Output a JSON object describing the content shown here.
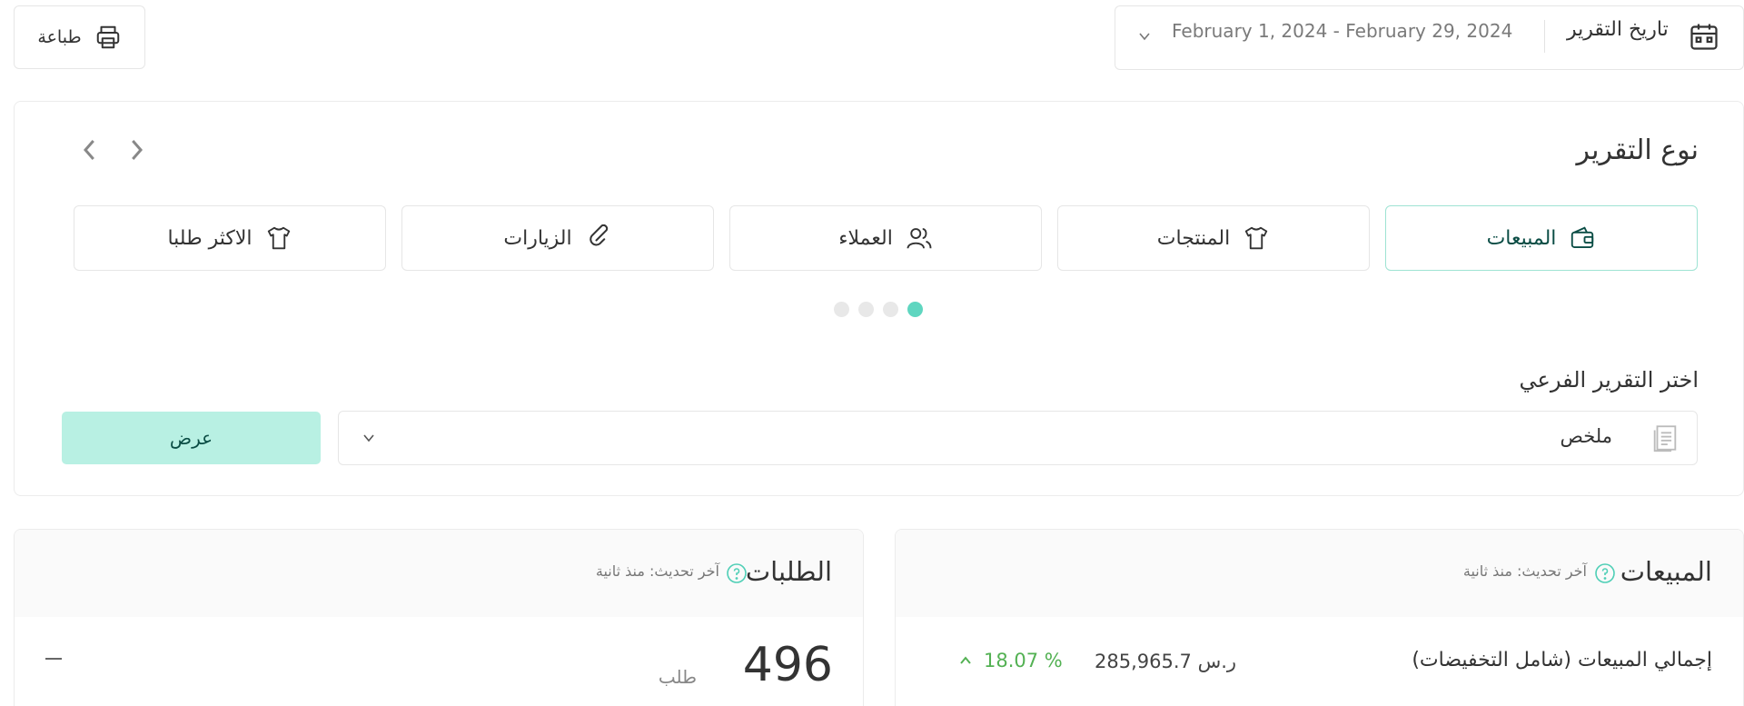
{
  "toolbar": {
    "print_label": "طباعة",
    "date_label": "تاريخ التقرير",
    "date_range": "February 1, 2024 - February 29, 2024"
  },
  "report_type": {
    "title": "نوع التقرير",
    "tabs": [
      {
        "label": "المبيعات",
        "icon": "wallet-icon",
        "active": true
      },
      {
        "label": "المنتجات",
        "icon": "tshirt-icon",
        "active": false
      },
      {
        "label": "العملاء",
        "icon": "users-icon",
        "active": false
      },
      {
        "label": "الزيارات",
        "icon": "link-icon",
        "active": false
      },
      {
        "label": "الاكثر طلبا",
        "icon": "tshirt-icon",
        "active": false
      }
    ],
    "pagination_active_index": 0,
    "pagination_count": 4
  },
  "sub_report": {
    "label": "اختر التقرير الفرعي",
    "selected": "ملخص",
    "show_label": "عرض"
  },
  "orders_card": {
    "title": "الطلبات",
    "updated": "آخر تحديث: منذ ثانية",
    "value": "496",
    "unit": "طلب"
  },
  "sales_card": {
    "title": "المبيعات",
    "updated": "آخر تحديث: منذ ثانية",
    "row_label": "إجمالي المبيعات (شامل التخفيضات)",
    "row_value": "285,965.7 ر.س",
    "row_change": "18.07 %"
  },
  "colors": {
    "accent": "#5fd6c0",
    "button_bg": "#b8f0e3",
    "positive": "#53b153"
  }
}
